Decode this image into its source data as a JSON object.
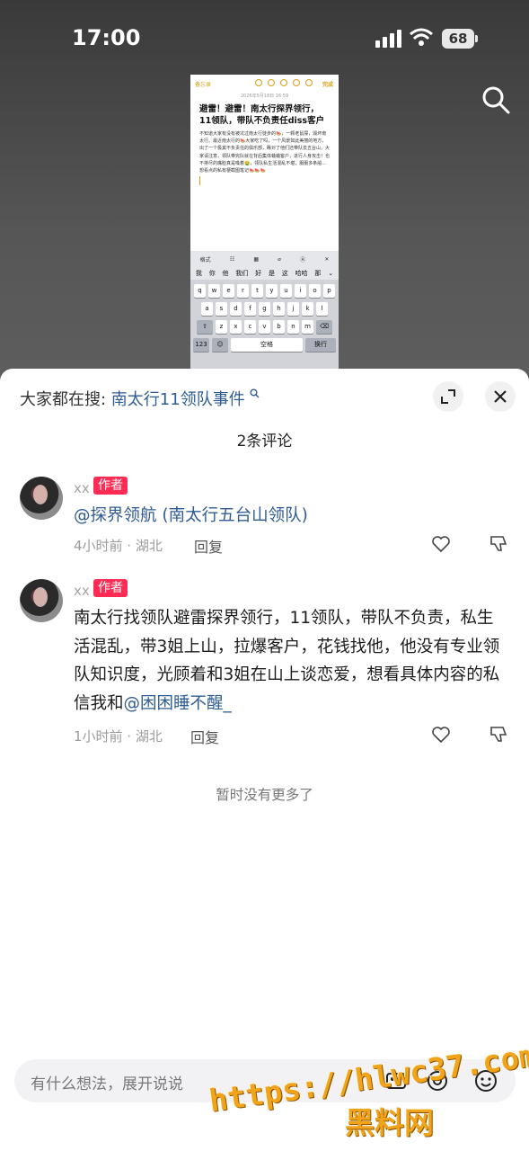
{
  "status": {
    "time": "17:00",
    "battery": "68"
  },
  "screenshot": {
    "back": "备忘录",
    "done": "完成",
    "date": "2026年5月18日 16:59",
    "title": "避雷！避雷！南太行探界领行，11领队，带队不负责任diss客户",
    "body": "不知道大家有没有被坑过南太行徒步的🍉，一颗老鼠屎，毁坏南太行。最近南太行的🍉大家吃了吗，一个风景如此美丽的地方，出了一个极其不负责任的俱乐部，瞧对了他们还带队去五台山，大家请注意，领队带完队就在背后集体蛐蛐客户，进行人身攻击！也不排尽的嘴脸真是嗓着🤮，领队私生活混乱不堪，服服多条船...想看点的私有梗截图笔记🍉🍉🍉",
    "toolbar": [
      "格式",
      "☷",
      "▦",
      "⌀",
      "Ⓐ",
      "✕"
    ],
    "candidates": [
      "我",
      "你",
      "他",
      "我们",
      "好",
      "是",
      "这",
      "哈哈",
      "那",
      "⌄"
    ],
    "row1": [
      "q",
      "w",
      "e",
      "r",
      "t",
      "y",
      "u",
      "i",
      "o",
      "p"
    ],
    "row2": [
      "a",
      "s",
      "d",
      "f",
      "g",
      "h",
      "j",
      "k",
      "l"
    ],
    "row3": [
      "⇧",
      "z",
      "x",
      "c",
      "v",
      "b",
      "n",
      "m",
      "⌫"
    ],
    "row4": [
      "123",
      "☺",
      "空格",
      "换行"
    ]
  },
  "sheet": {
    "search_prefix": "大家都在搜: ",
    "search_query": "南太行11领队事件",
    "count_title": "2条评论",
    "no_more": "暂时没有更多了"
  },
  "comments": [
    {
      "user": "xx",
      "badge": "作者",
      "mention": "@探界领航 (南太行五台山领队)",
      "meta": "4小时前 · 湖北",
      "reply": "回复"
    },
    {
      "user": "xx",
      "badge": "作者",
      "text": "南太行找领队避雷探界领行，11领队，带队不负责，私生活混乱，带3姐上山，拉爆客户，花钱找他，他没有专业领队知识度，光顾着和3姐在山上谈恋爱，想看具体内容的私信我和",
      "mention": "@困困睡不醒_",
      "meta": "1小时前 · 湖北",
      "reply": "回复"
    }
  ],
  "input": {
    "placeholder": "有什么想法，展开说说"
  },
  "watermark": {
    "url": "https://hlwc37.com",
    "name": "黑料网"
  },
  "icons": [
    "signal-icon",
    "wifi-icon",
    "search-icon",
    "expand-icon",
    "close-icon",
    "like-icon",
    "dislike-icon",
    "image-icon",
    "at-icon",
    "emoji-icon"
  ],
  "colors": {
    "accent_link": "#2f5c93",
    "badge": "#fe2c55",
    "watermark": "#f1a419"
  }
}
